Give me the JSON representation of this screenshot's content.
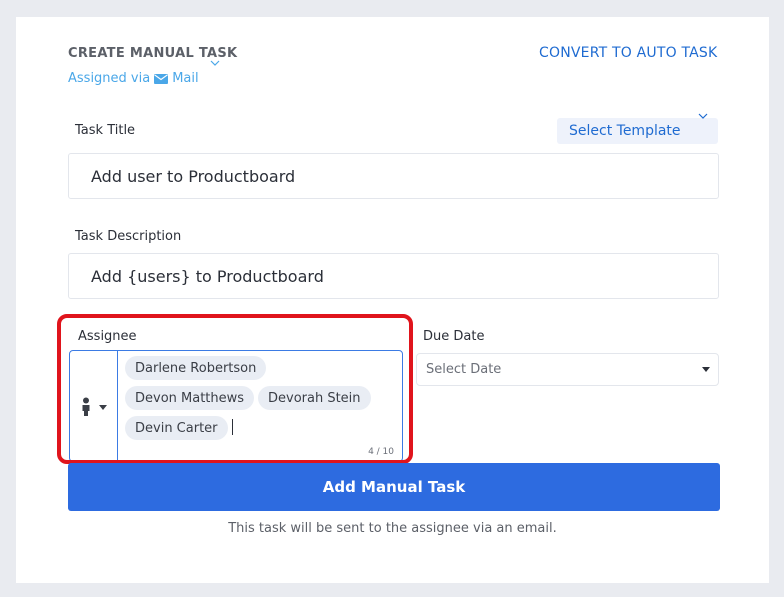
{
  "header": {
    "title": "CREATE MANUAL TASK",
    "assigned_via": "Assigned via",
    "channel": "Mail",
    "convert_label": "CONVERT TO AUTO TASK"
  },
  "task_title": {
    "label": "Task Title",
    "value": "Add user to Productboard",
    "template_label": "Select Template"
  },
  "task_description": {
    "label": "Task Description",
    "value": "Add {users} to Productboard"
  },
  "assignee": {
    "label": "Assignee",
    "chips": [
      "Darlene Robertson",
      "Devon Matthews",
      "Devorah Stein",
      "Devin Carter"
    ],
    "counter": "4 / 10"
  },
  "due_date": {
    "label": "Due Date",
    "placeholder": "Select Date"
  },
  "submit": {
    "label": "Add Manual Task",
    "footnote": "This task will be sent to the assignee via an email."
  },
  "colors": {
    "primary": "#2d6be0",
    "link": "#1f6bd1",
    "highlight": "#e0141c",
    "mail": "#4aa7e8"
  }
}
